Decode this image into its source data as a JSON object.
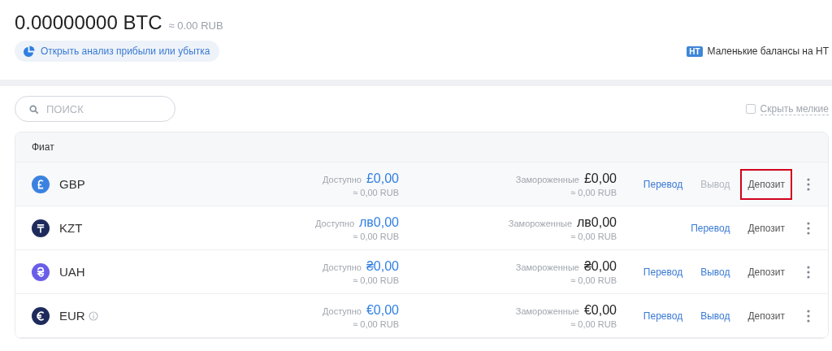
{
  "balance": {
    "amount": "0.00000000 BTC",
    "approx": "≈ 0.00 RUB"
  },
  "pnl_button": {
    "label": "Открыть анализ прибыли или убытка"
  },
  "small_balances_link": {
    "badge": "HT",
    "label": "Маленькие балансы на HT"
  },
  "search": {
    "placeholder": "ПОИСК"
  },
  "hide_small": {
    "label": "Скрыть мелкие",
    "checked": false
  },
  "section": {
    "title": "Фиат"
  },
  "rows": [
    {
      "currency": "GBP",
      "kind": "pound",
      "color": "#3b82e0",
      "info": false,
      "hovered": true,
      "available_label": "Доступно",
      "available": "£0,00",
      "available_rub": "≈ 0,00 RUB",
      "frozen_label": "Замороженные",
      "frozen": "£0,00",
      "frozen_rub": "≈ 0,00 RUB",
      "actions": [
        {
          "label": "Перевод",
          "kind": "link",
          "disabled": false,
          "highlighted": false
        },
        {
          "label": "Вывод",
          "kind": "link",
          "disabled": true,
          "highlighted": false
        },
        {
          "label": "Депозит",
          "kind": "plain",
          "disabled": false,
          "highlighted": true
        }
      ]
    },
    {
      "currency": "KZT",
      "kind": "tenge",
      "color": "#1f2a5c",
      "info": false,
      "hovered": false,
      "available_label": "Доступно",
      "available": "лв0,00",
      "available_rub": "≈ 0,00 RUB",
      "frozen_label": "Замороженные",
      "frozen": "лв0,00",
      "frozen_rub": "≈ 0,00 RUB",
      "actions": [
        {
          "label": "Перевод",
          "kind": "link",
          "disabled": false,
          "highlighted": false
        },
        {
          "label": "Депозит",
          "kind": "plain",
          "disabled": false,
          "highlighted": false
        }
      ]
    },
    {
      "currency": "UAH",
      "kind": "hryvnia",
      "color": "#6a5ee8",
      "info": false,
      "hovered": false,
      "available_label": "Доступно",
      "available": "₴0,00",
      "available_rub": "≈ 0,00 RUB",
      "frozen_label": "Замороженные",
      "frozen": "₴0,00",
      "frozen_rub": "≈ 0,00 RUB",
      "actions": [
        {
          "label": "Перевод",
          "kind": "link",
          "disabled": false,
          "highlighted": false
        },
        {
          "label": "Вывод",
          "kind": "link",
          "disabled": false,
          "highlighted": false
        },
        {
          "label": "Депозит",
          "kind": "plain",
          "disabled": false,
          "highlighted": false
        }
      ]
    },
    {
      "currency": "EUR",
      "kind": "euro",
      "color": "#1f2a5c",
      "info": true,
      "hovered": false,
      "available_label": "Доступно",
      "available": "€0,00",
      "available_rub": "≈ 0,00 RUB",
      "frozen_label": "Замороженные",
      "frozen": "€0,00",
      "frozen_rub": "≈ 0,00 RUB",
      "actions": [
        {
          "label": "Перевод",
          "kind": "link",
          "disabled": false,
          "highlighted": false
        },
        {
          "label": "Вывод",
          "kind": "link",
          "disabled": false,
          "highlighted": false
        },
        {
          "label": "Депозит",
          "kind": "plain",
          "disabled": false,
          "highlighted": false
        }
      ]
    }
  ]
}
